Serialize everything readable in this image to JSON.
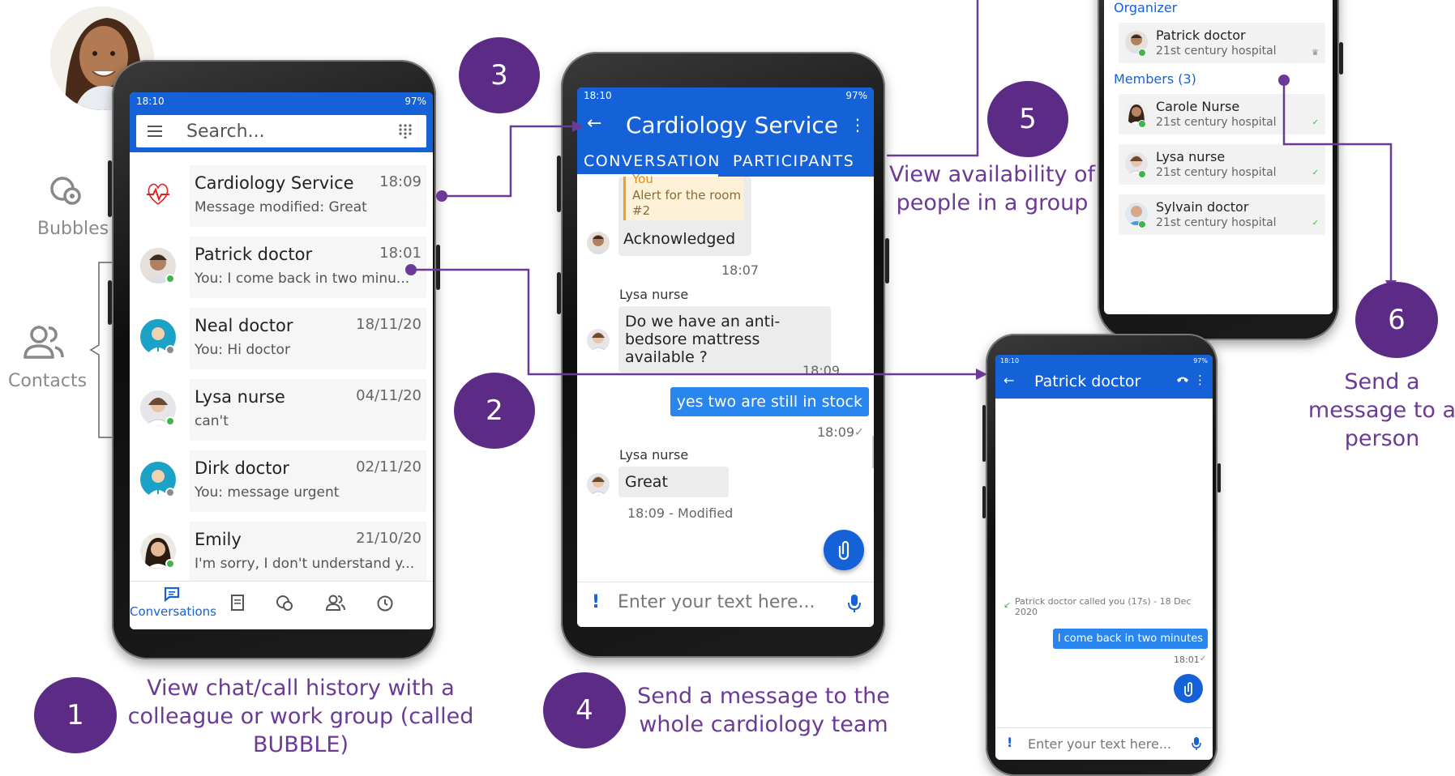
{
  "phone1": {
    "status_time": "18:10",
    "battery": "97%",
    "search_placeholder": "Search...",
    "conversations": [
      {
        "name": "Cardiology Service",
        "time": "18:09",
        "preview": "Message modified: Great",
        "avatar": "heart-logo",
        "presence": ""
      },
      {
        "name": "Patrick doctor",
        "time": "18:01",
        "preview": "You: I come back in two minu...",
        "avatar": "patrick-avatar",
        "presence": "online"
      },
      {
        "name": "Neal doctor",
        "time": "18/11/20",
        "preview": "You: Hi doctor",
        "avatar": "doctor-avatar",
        "presence": "offline"
      },
      {
        "name": "Lysa nurse",
        "time": "04/11/20",
        "preview": "can't",
        "avatar": "lysa-avatar",
        "presence": "online"
      },
      {
        "name": "Dirk doctor",
        "time": "02/11/20",
        "preview": "You: message urgent",
        "avatar": "doctor-avatar",
        "presence": "offline"
      },
      {
        "name": "Emily",
        "time": "21/10/20",
        "preview": "I'm sorry, I don't understand y...",
        "avatar": "emily-avatar",
        "presence": "online"
      }
    ],
    "nav_active_label": "Conversations"
  },
  "phone2": {
    "status_time": "18:10",
    "battery": "97%",
    "title": "Cardiology Service",
    "tabs": [
      "CONVERSATION",
      "PARTICIPANTS"
    ],
    "quote_author": "You",
    "quote_text": "Alert for the room #2",
    "msg_ack": "Acknowledged",
    "msg_ack_time": "18:07",
    "sender1": "Lysa nurse",
    "msg_question": "Do we have an anti-bedsore mattress available ?",
    "msg_question_time": "18:09",
    "msg_out": "yes two are still in stock",
    "msg_out_time": "18:09",
    "sender2": "Lysa nurse",
    "msg_great": "Great",
    "msg_great_meta": "18:09 - Modified",
    "input_placeholder": "Enter your text here..."
  },
  "phone3": {
    "organizer_label": "Organizer",
    "organizer": {
      "name": "Patrick doctor",
      "hospital": "21st century hospital"
    },
    "members_label": "Members (3)",
    "members": [
      {
        "name": "Carole Nurse",
        "hospital": "21st century hospital"
      },
      {
        "name": "Lysa nurse",
        "hospital": "21st century hospital"
      },
      {
        "name": "Sylvain doctor",
        "hospital": "21st century hospital"
      }
    ]
  },
  "phone4": {
    "status_time": "18:10",
    "battery": "97%",
    "title": "Patrick doctor",
    "call_log": "Patrick doctor called you (17s) - 18 Dec 2020",
    "msg_out": "I come back in two minutes",
    "msg_out_time": "18:01",
    "input_placeholder": "Enter your text here..."
  },
  "side": {
    "bubbles": "Bubbles",
    "contacts": "Contacts"
  },
  "steps": [
    {
      "num": "1",
      "text": "View chat/call history with a colleague or work group  (called BUBBLE)"
    },
    {
      "num": "2",
      "text": ""
    },
    {
      "num": "3",
      "text": ""
    },
    {
      "num": "4",
      "text": "Send a message to the whole cardiology team"
    },
    {
      "num": "5",
      "text": "View availability of people in a group"
    },
    {
      "num": "6",
      "text": "Send a message to a person"
    }
  ],
  "colors": {
    "brand_blue": "#1561d7",
    "step_purple": "#5b2b86",
    "text_purple": "#6b3a96",
    "online": "#41b44c"
  }
}
